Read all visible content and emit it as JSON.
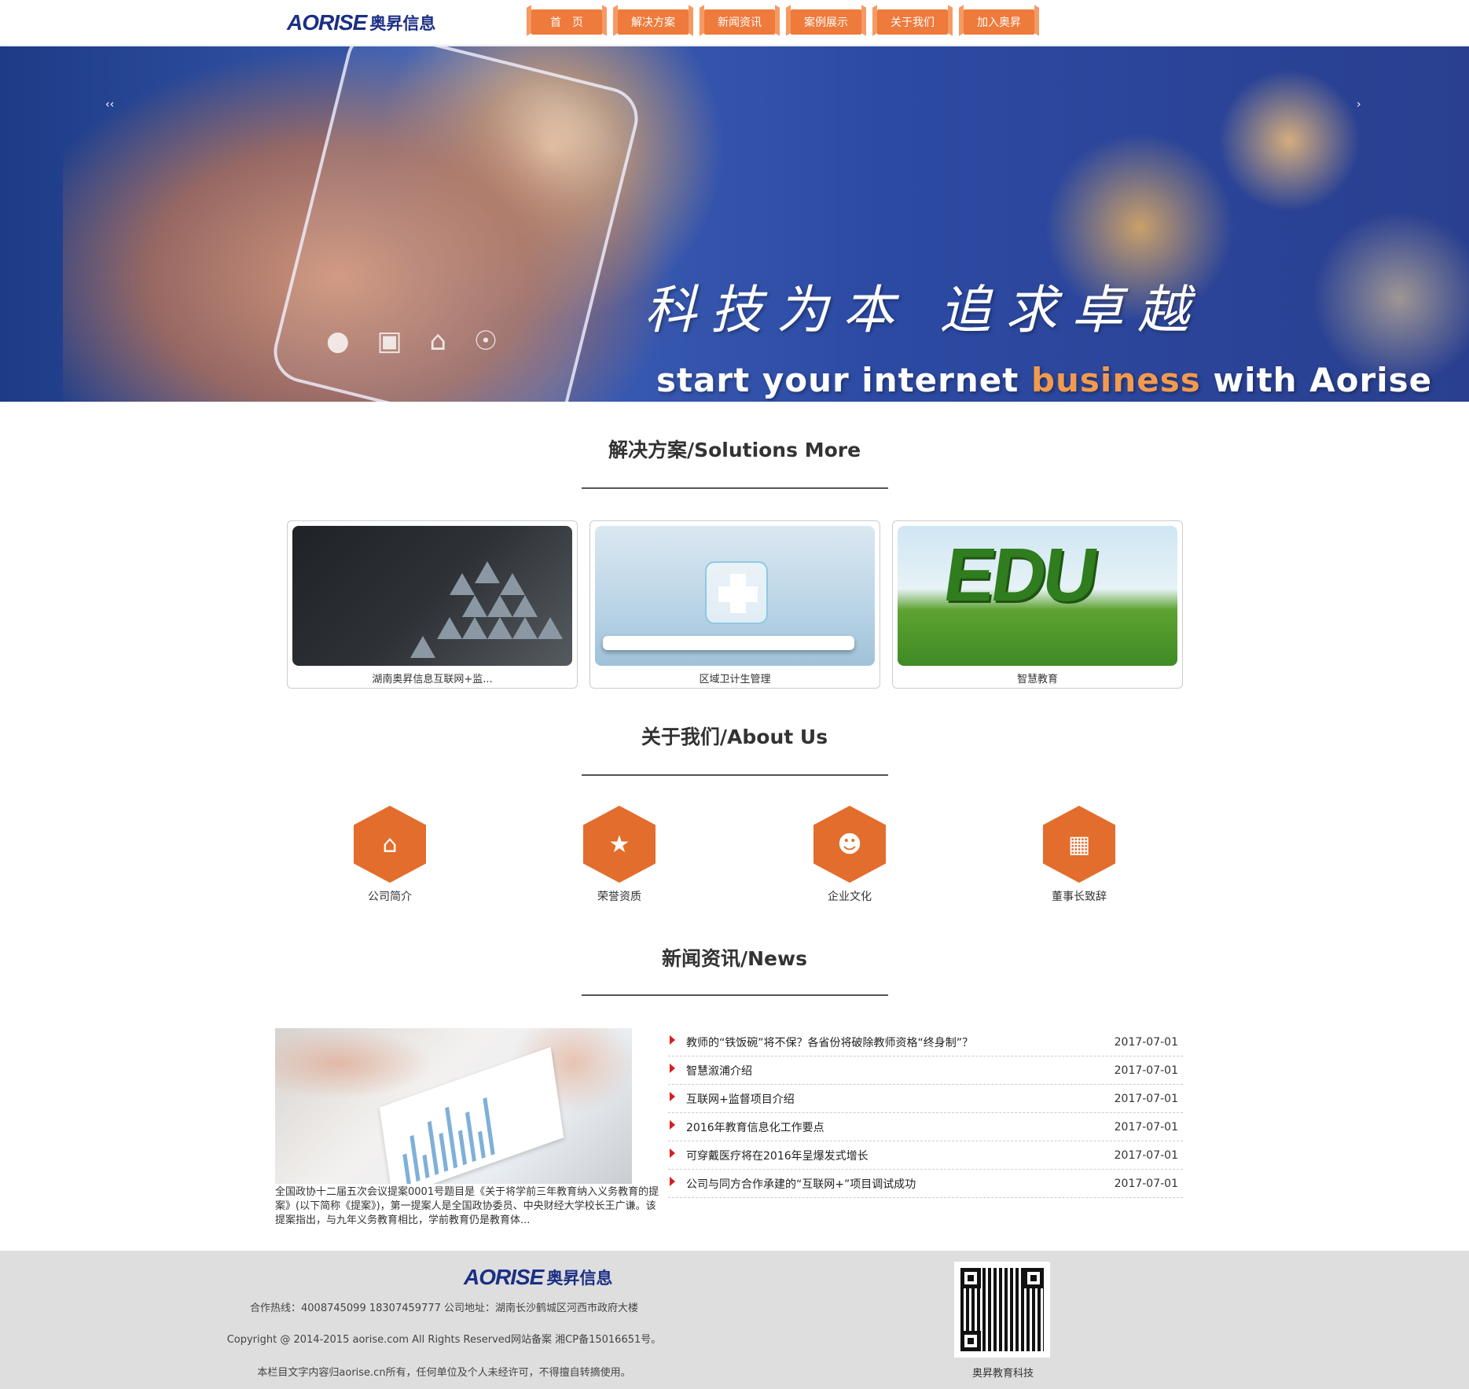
{
  "header": {
    "logo_mark": "AORISE",
    "logo_cn": "奥昇信息",
    "nav": [
      "首　页",
      "解决方案",
      "新闻资讯",
      "案例展示",
      "关于我们",
      "加入奥昇"
    ]
  },
  "banner": {
    "slogan_cn": "科技为本 追求卓越",
    "slogan_en_1": "start your internet ",
    "slogan_en_hl": "business",
    "slogan_en_2": " with Aorise",
    "arrow_left": "‹‹",
    "arrow_right": "›",
    "active_slide": 1,
    "slide_count": 3
  },
  "solutions": {
    "title": "解决方案/Solutions More",
    "items": [
      {
        "label": "湖南奥昇信息互联网+监..."
      },
      {
        "label": "区域卫计生管理"
      },
      {
        "label": "智慧教育"
      }
    ],
    "edu_text": "EDU"
  },
  "about": {
    "title": "关于我们/About Us",
    "items": [
      {
        "label": "公司简介",
        "icon": "home-icon"
      },
      {
        "label": "荣誉资质",
        "icon": "trophy-icon"
      },
      {
        "label": "企业文化",
        "icon": "group-icon"
      },
      {
        "label": "董事长致辞",
        "icon": "grid-icon"
      }
    ]
  },
  "news": {
    "title": "新闻资讯/News",
    "featured_desc": "全国政协十二届五次会议提案0001号题目是《关于将学前三年教育纳入义务教育的提案》(以下简称《提案》)，第一提案人是全国政协委员、中央财经大学校长王广谦。该提案指出，与九年义务教育相比，学前教育仍是教育体...",
    "items": [
      {
        "title": "教师的“铁饭碗”将不保？各省份将破除教师资格“终身制”？",
        "date": "2017-07-01"
      },
      {
        "title": "智慧溆浦介绍",
        "date": "2017-07-01"
      },
      {
        "title": "互联网+监督项目介绍",
        "date": "2017-07-01"
      },
      {
        "title": "2016年教育信息化工作要点",
        "date": "2017-07-01"
      },
      {
        "title": "可穿戴医疗将在2016年呈爆发式增长",
        "date": "2017-07-01"
      },
      {
        "title": "公司与同方合作承建的“互联网+”项目调试成功",
        "date": "2017-07-01"
      }
    ]
  },
  "footer": {
    "logo_mark": "AORISE",
    "logo_cn": "奥昇信息",
    "contact": "合作热线：4008745099 18307459777 公司地址：湖南长沙鹤城区河西市政府大楼",
    "copyright": "Copyright @ 2014-2015 aorise.com All Rights Reserved网站备案 湘CP备15016651号。",
    "notice": "本栏目文字内容归aorise.cn所有，任何单位及个人未经许可，不得擅自转摘使用。",
    "qr_label": "奥昇教育科技"
  },
  "colors": {
    "accent": "#ee7a3b",
    "hex": "#e36d2c",
    "brand": "#1b2f84",
    "news_marker": "#d81e1e"
  }
}
